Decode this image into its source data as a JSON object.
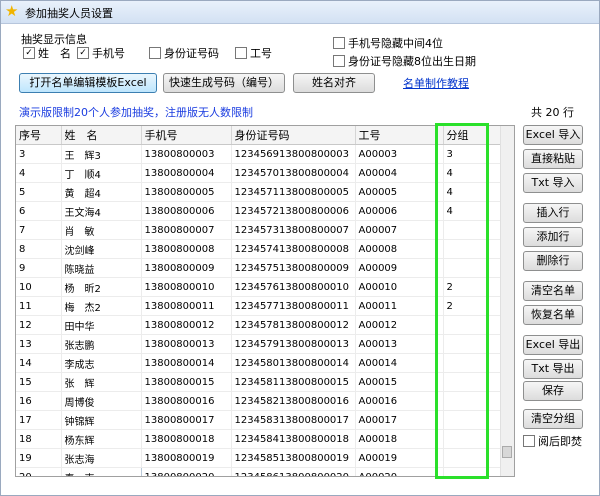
{
  "window": {
    "title": "参加抽奖人员设置"
  },
  "display_group": {
    "label": "抽奖显示信息",
    "show_name": {
      "label": "姓　名",
      "checked": true
    },
    "show_phone": {
      "label": "手机号",
      "checked": true
    },
    "show_id": {
      "label": "身份证号码",
      "checked": false
    },
    "show_empno": {
      "label": "工号",
      "checked": false
    }
  },
  "privacy": {
    "hide_phone_middle": {
      "label": "手机号隐藏中间4位",
      "checked": false
    },
    "hide_id_birth": {
      "label": "身份证号隐藏8位出生日期",
      "checked": false
    }
  },
  "toolbar": {
    "open_template": "打开名单编辑模板Excel",
    "quick_gen": "快速生成号码（编号）",
    "align_names": "姓名对齐",
    "tutorial_link": "名单制作教程"
  },
  "notice": "演示版限制20个人参加抽奖，注册版无人数限制",
  "total": "共 20 行",
  "table": {
    "columns": [
      "序号",
      "姓　名",
      "手机号",
      "身份证号码",
      "工号",
      "分组"
    ],
    "rows": [
      [
        "3",
        "王　辉3",
        "13800800003",
        "123456913800800003",
        "A00003",
        "3"
      ],
      [
        "4",
        "丁　顺4",
        "13800800004",
        "123457013800800004",
        "A00004",
        "4"
      ],
      [
        "5",
        "黄　超4",
        "13800800005",
        "123457113800800005",
        "A00005",
        "4"
      ],
      [
        "6",
        "王文海4",
        "13800800006",
        "123457213800800006",
        "A00006",
        "4"
      ],
      [
        "7",
        "肖　敏",
        "13800800007",
        "123457313800800007",
        "A00007",
        ""
      ],
      [
        "8",
        "沈剑峰",
        "13800800008",
        "123457413800800008",
        "A00008",
        ""
      ],
      [
        "9",
        "陈晓益",
        "13800800009",
        "123457513800800009",
        "A00009",
        ""
      ],
      [
        "10",
        "杨　昕2",
        "13800800010",
        "123457613800800010",
        "A00010",
        "2"
      ],
      [
        "11",
        "梅　杰2",
        "13800800011",
        "123457713800800011",
        "A00011",
        "2"
      ],
      [
        "12",
        "田中华",
        "13800800012",
        "123457813800800012",
        "A00012",
        ""
      ],
      [
        "13",
        "张志鹏",
        "13800800013",
        "123457913800800013",
        "A00013",
        ""
      ],
      [
        "14",
        "李成志",
        "13800800014",
        "123458013800800014",
        "A00014",
        ""
      ],
      [
        "15",
        "张　辉",
        "13800800015",
        "123458113800800015",
        "A00015",
        ""
      ],
      [
        "16",
        "周博俊",
        "13800800016",
        "123458213800800016",
        "A00016",
        ""
      ],
      [
        "17",
        "钟锦辉",
        "13800800017",
        "123458313800800017",
        "A00017",
        ""
      ],
      [
        "18",
        "杨东辉",
        "13800800018",
        "123458413800800018",
        "A00018",
        ""
      ],
      [
        "19",
        "张志海",
        "13800800019",
        "123458513800800019",
        "A00019",
        ""
      ],
      [
        "20",
        "秦　声",
        "13800800020",
        "123458613800800020",
        "A00020",
        ""
      ]
    ]
  },
  "side_buttons": {
    "excel_import": "Excel 导入",
    "paste": "直接粘贴",
    "txt_import": "Txt 导入",
    "insert_row": "插入行",
    "add_row": "添加行",
    "delete_row": "删除行",
    "clear_list": "清空名单",
    "restore_list": "恢复名单",
    "excel_export": "Excel 导出",
    "txt_export": "Txt 导出",
    "save": "保存",
    "clear_group": "清空分组",
    "burn_after_read": {
      "label": "阅后即焚",
      "checked": false
    }
  },
  "colors": {
    "highlight_box": "#2ae02a",
    "notice_text": "#1a3ce0",
    "link": "#0033cc"
  }
}
